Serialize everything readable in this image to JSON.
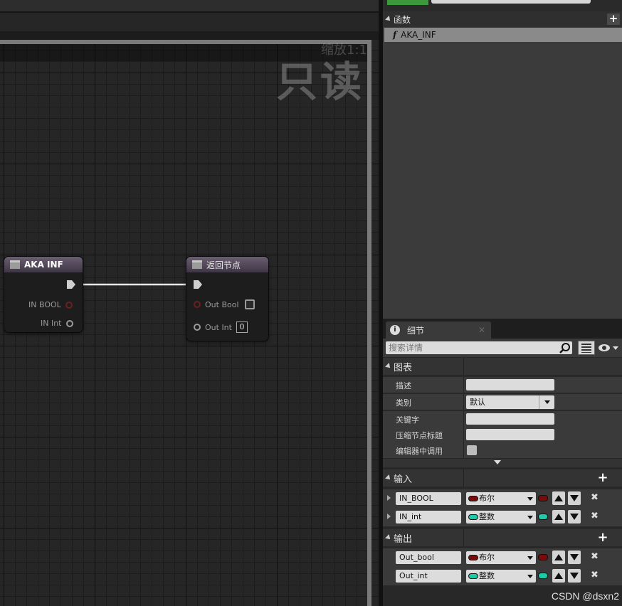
{
  "graph": {
    "zoom_label": "缩放1:1",
    "readonly_label": "只读",
    "nodes": {
      "entry": {
        "title": "AKA INF",
        "pins": [
          "IN BOOL",
          "IN Int"
        ]
      },
      "return": {
        "title": "返回节点",
        "pins": [
          "Out Bool",
          "Out Int"
        ],
        "int_default": "0"
      }
    }
  },
  "functions": {
    "header": "函数",
    "add_icon": "plus-icon",
    "items": [
      {
        "icon": "function-icon",
        "label": "AKA_INF"
      }
    ]
  },
  "details": {
    "tab_label": "细节",
    "search_placeholder": "搜索详情",
    "graph_section": {
      "title": "图表",
      "rows": [
        {
          "label": "描述",
          "kind": "text",
          "value": ""
        },
        {
          "label": "类别",
          "kind": "select",
          "value": "默认"
        },
        {
          "label": "关键字",
          "kind": "text",
          "value": ""
        },
        {
          "label": "压缩节点标题",
          "kind": "text",
          "value": ""
        },
        {
          "label": "编辑器中调用",
          "kind": "checkbox",
          "checked": false
        }
      ]
    },
    "inputs_section": {
      "title": "输入",
      "params": [
        {
          "name": "IN_BOOL",
          "type": "布尔",
          "color": "#7a0b0b"
        },
        {
          "name": "IN_int",
          "type": "整数",
          "color": "#1ec9a7"
        }
      ]
    },
    "outputs_section": {
      "title": "输出",
      "params": [
        {
          "name": "Out_bool",
          "type": "布尔",
          "color": "#7a0b0b"
        },
        {
          "name": "Out_int",
          "type": "整数",
          "color": "#1ec9a7"
        }
      ]
    }
  },
  "watermark": "CSDN @dsxn2"
}
